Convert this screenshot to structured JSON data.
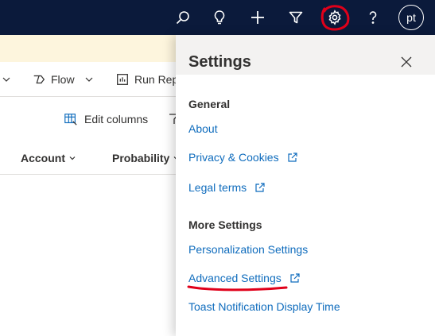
{
  "topbar": {
    "icons": [
      "search-icon",
      "lightbulb-icon",
      "plus-icon",
      "filter-icon",
      "gear-icon",
      "help-icon"
    ],
    "avatar_initials": "pt",
    "background": "#0b1a3b"
  },
  "commandbar": {
    "flow_label": "Flow",
    "run_report_label": "Run Repo"
  },
  "grid": {
    "edit_columns_label": "Edit columns",
    "columns": [
      "Account",
      "Probability"
    ]
  },
  "settings_panel": {
    "title": "Settings",
    "general": {
      "heading": "General",
      "links": [
        "About",
        "Privacy & Cookies",
        "Legal terms"
      ]
    },
    "more": {
      "heading": "More Settings",
      "links": [
        "Personalization Settings",
        "Advanced Settings",
        "Toast Notification Display Time"
      ]
    },
    "link_color": "#0f6cbd"
  },
  "annotation_color": "#e0001a"
}
